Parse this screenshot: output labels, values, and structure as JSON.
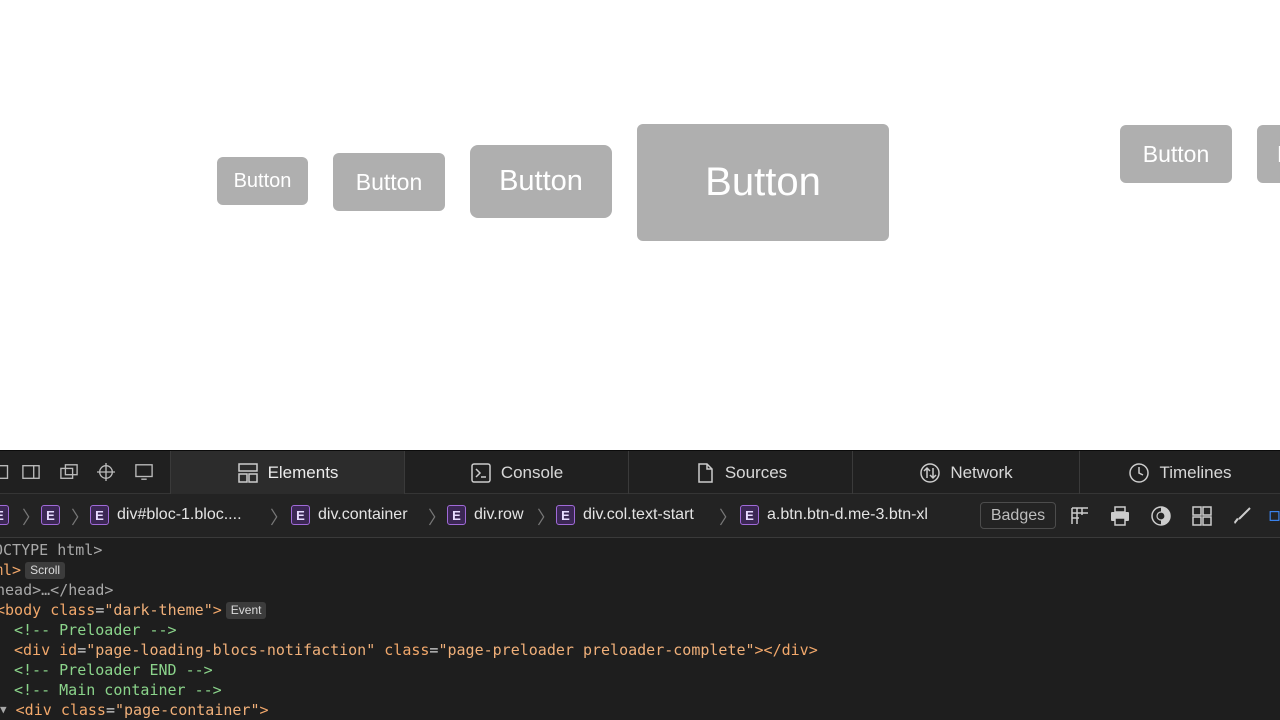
{
  "preview": {
    "buttons": [
      "Button",
      "Button",
      "Button",
      "Button",
      "Button",
      "B"
    ]
  },
  "devtools": {
    "tabs": [
      {
        "label": "Elements",
        "icon": "elements-icon",
        "active": true
      },
      {
        "label": "Console",
        "icon": "console-icon"
      },
      {
        "label": "Sources",
        "icon": "sources-icon"
      },
      {
        "label": "Network",
        "icon": "network-icon"
      },
      {
        "label": "Timelines",
        "icon": "timelines-icon"
      }
    ],
    "breadcrumbs": {
      "first_badge": "E",
      "second_badge": "E",
      "items": [
        {
          "badge": "E",
          "label": "div#bloc-1.bloc...."
        },
        {
          "badge": "E",
          "label": "div.container"
        },
        {
          "badge": "E",
          "label": "div.row"
        },
        {
          "badge": "E",
          "label": "div.col.text-start"
        },
        {
          "badge": "E",
          "label": "a.btn.btn-d.me-3.btn-xl"
        }
      ],
      "badges_button": "Badges"
    },
    "dom": {
      "doctype": "OCTYPE html>",
      "html_open": "ml>",
      "scroll_pill": "Scroll",
      "head": "head>…</head>",
      "body_tag": "body",
      "body_attr": "class",
      "body_val": "\"dark-theme\"",
      "event_pill": "Event",
      "c_preloader": "<!-- Preloader -->",
      "div_tag": "<div",
      "id_attr": "id",
      "id_val": "\"page-loading-blocs-notifaction\"",
      "class_attr": "class",
      "class_val": "\"page-preloader preloader-complete\"",
      "div_close": "></div>",
      "c_preloader_end": "<!-- Preloader END -->",
      "c_main": "<!-- Main container -->",
      "container_tag": "<div",
      "container_attr": "class",
      "container_val": "\"page-container\"",
      "container_close": ">"
    }
  }
}
